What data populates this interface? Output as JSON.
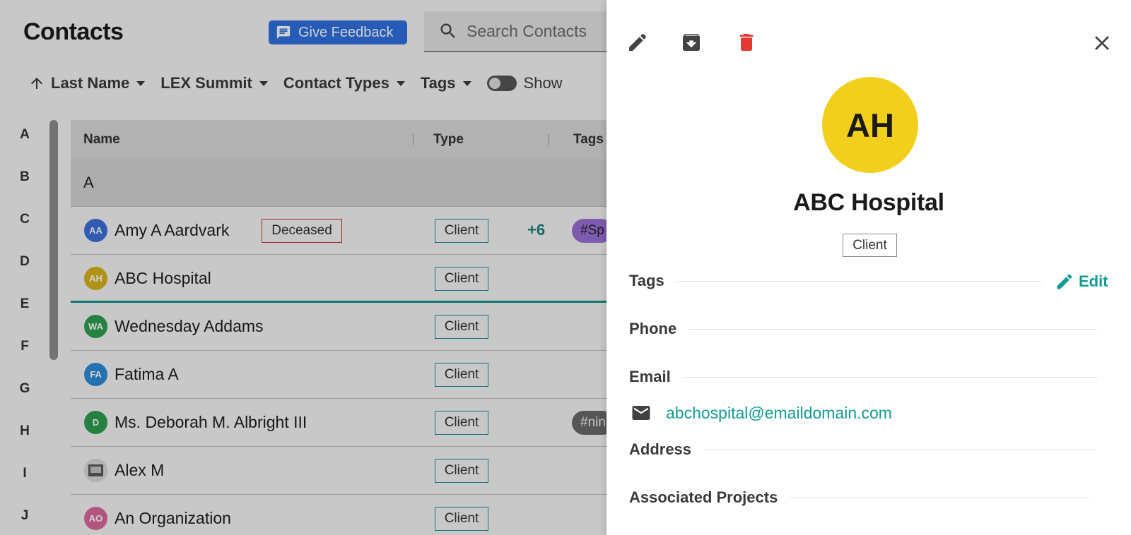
{
  "header": {
    "title": "Contacts",
    "feedback_label": "Give Feedback",
    "search_placeholder": "Search Contacts"
  },
  "filters": {
    "sort_label": "Last Name",
    "items": [
      "LEX Summit",
      "Contact Types",
      "Tags"
    ],
    "toggle_label": "Show"
  },
  "alpha_nav": [
    "A",
    "B",
    "C",
    "D",
    "E",
    "F",
    "G",
    "H",
    "I",
    "J"
  ],
  "table": {
    "columns": [
      "Name",
      "Type",
      "Tags"
    ],
    "group": "A",
    "rows": [
      {
        "initials": "AA",
        "name": "Amy A Aardvark",
        "avatar_color": "#3b6fd9",
        "status": "Deceased",
        "type": "Client",
        "more": "+6",
        "tag": "#Sp",
        "tag_color": "#9b6fd6",
        "tag_text_color": "#222222"
      },
      {
        "initials": "AH",
        "name": "ABC Hospital",
        "avatar_color": "#d6b21b",
        "type": "Client",
        "selected": true
      },
      {
        "initials": "WA",
        "name": "Wednesday Addams",
        "avatar_color": "#2e9e4f",
        "type": "Client"
      },
      {
        "initials": "FA",
        "name": "Fatima A",
        "avatar_color": "#2d8cd6",
        "type": "Client"
      },
      {
        "initials": "D",
        "name": "Ms. Deborah M. Albright III",
        "avatar_color": "#2e9e4f",
        "type": "Client",
        "tag": "#nin",
        "tag_color": "#6a6a6a",
        "tag_text_color": "#eeeeee"
      },
      {
        "initials": "",
        "name": "Alex M",
        "avatar_color": "#777777",
        "type": "Client",
        "photo": true
      },
      {
        "initials": "AO",
        "name": "An Organization",
        "avatar_color": "#d9689b",
        "type": "Client"
      }
    ]
  },
  "panel": {
    "toolbar": {
      "edit_icon": "pencil-icon",
      "archive_icon": "archive-icon",
      "delete_icon": "trash-icon",
      "close_icon": "close-icon"
    },
    "avatar_initials": "AH",
    "avatar_color": "#f2cf1d",
    "name": "ABC Hospital",
    "type": "Client",
    "sections": {
      "tags": "Tags",
      "edit": "Edit",
      "phone": "Phone",
      "email": "Email",
      "address": "Address",
      "projects": "Associated Projects"
    },
    "email_value": "abchospital@emaildomain.com"
  },
  "colors": {
    "accent": "#129b94",
    "delete": "#e53935",
    "feedback": "#2f6fe0"
  }
}
